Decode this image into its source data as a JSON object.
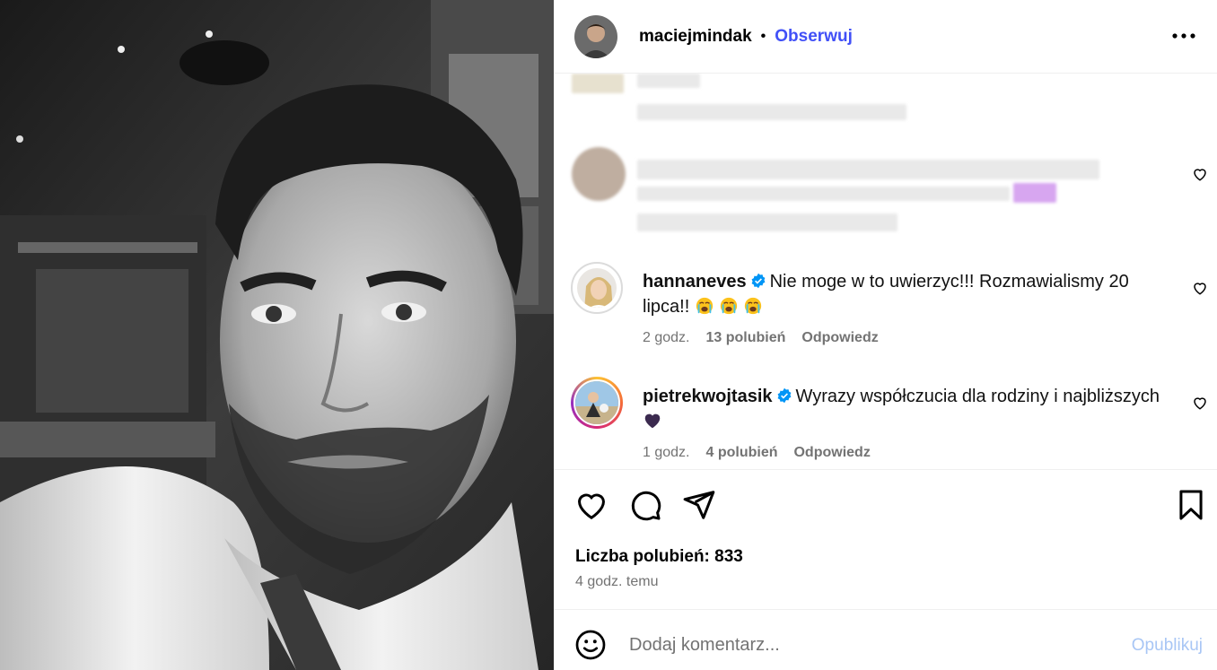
{
  "post": {
    "author": "maciejmindak",
    "separator": "•",
    "follow_label": "Obserwuj",
    "more_label": "•••"
  },
  "comments": [
    {
      "user": "hannaneves",
      "verified": true,
      "text": "Nie moge w to uwierzyc!!! Rozmawialismy 20 lipca!!",
      "emojis": [
        "crying-face",
        "crying-face",
        "crying-face"
      ],
      "time": "2 godz.",
      "likes": "13 polubień",
      "reply": "Odpowiedz"
    },
    {
      "user": "pietrekwojtasik",
      "verified": true,
      "text": "Wyrazy współczucia dla rodziny i najbliższych",
      "emojis": [
        "purple-heart"
      ],
      "time": "1 godz.",
      "likes": "4 polubień",
      "reply": "Odpowiedz"
    }
  ],
  "stats": {
    "likes": "Liczba polubień: 833",
    "posted": "4 godz. temu"
  },
  "add_comment": {
    "placeholder": "Dodaj komentarz...",
    "publish_label": "Opublikuj"
  },
  "colors": {
    "link_blue": "#4150f7",
    "publish_disabled": "#a8c6f5",
    "meta_grey": "#737373",
    "verified_blue": "#0095f6"
  },
  "icons": [
    "heart-icon",
    "comment-icon",
    "share-icon",
    "bookmark-icon",
    "emoji-icon",
    "verified-icon",
    "more-icon"
  ]
}
